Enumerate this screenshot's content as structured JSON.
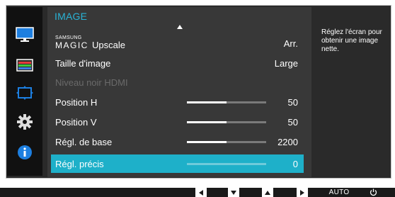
{
  "menu": {
    "title": "IMAGE",
    "items": [
      {
        "samsung": "SAMSUNG",
        "magic": "MAGIC",
        "label": "Upscale",
        "value": "Arr."
      },
      {
        "label": "Taille d'image",
        "value": "Large"
      },
      {
        "label": "Niveau noir HDMI",
        "value": "",
        "disabled": true
      },
      {
        "label": "Position H",
        "value": "50",
        "slider_fraction": 0.5
      },
      {
        "label": "Position V",
        "value": "50",
        "slider_fraction": 0.5
      },
      {
        "label": "Régl. de base",
        "value": "2200",
        "slider_fraction": 0.5
      },
      {
        "label": "Régl. précis",
        "value": "0",
        "slider_fraction": 0.0,
        "selected": true
      }
    ]
  },
  "sidebar": {
    "icons": [
      "monitor-icon",
      "color-settings-icon",
      "resize-icon",
      "gear-icon",
      "info-icon"
    ],
    "active": "monitor-icon"
  },
  "help": {
    "text": "Réglez l'écran pour obtenir une image nette."
  },
  "bottom_bar": {
    "buttons": [
      "left-arrow-icon",
      "down-arrow-icon",
      "up-arrow-icon",
      "right-arrow-icon"
    ],
    "auto_label": "AUTO",
    "power_icon": "power-icon"
  },
  "colors": {
    "accent": "#1eb0c9",
    "title": "#29b3d6",
    "panel": "#383838",
    "frame": "#2a2a2a",
    "disabled_text": "#6a6a6a"
  }
}
